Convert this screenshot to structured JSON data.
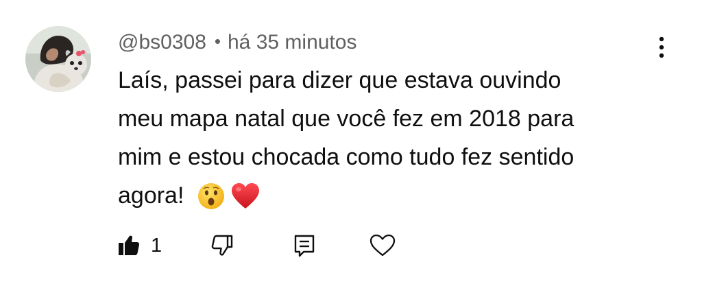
{
  "comment": {
    "author_handle": "@bs0308",
    "separator": "•",
    "timestamp": "há 35 minutos",
    "text_lines": [
      "Laís, passei para dizer que estava ouvindo",
      "meu mapa natal que você fez em 2018 para",
      "mim e estou chocada como tudo fez sentido",
      "agora!"
    ],
    "emojis": [
      "astonished-face-emoji",
      "red-heart-emoji"
    ],
    "like_count": "1"
  },
  "icons": {
    "menu": "more-vertical-icon",
    "like": "thumbs-up-filled-icon",
    "dislike": "thumbs-down-icon",
    "reply": "reply-comment-icon",
    "heart": "heart-outline-icon"
  },
  "colors": {
    "text": "#0f0f0f",
    "meta": "#606060",
    "heart_emoji": "#e0242f",
    "face_emoji": "#f7c21b"
  }
}
